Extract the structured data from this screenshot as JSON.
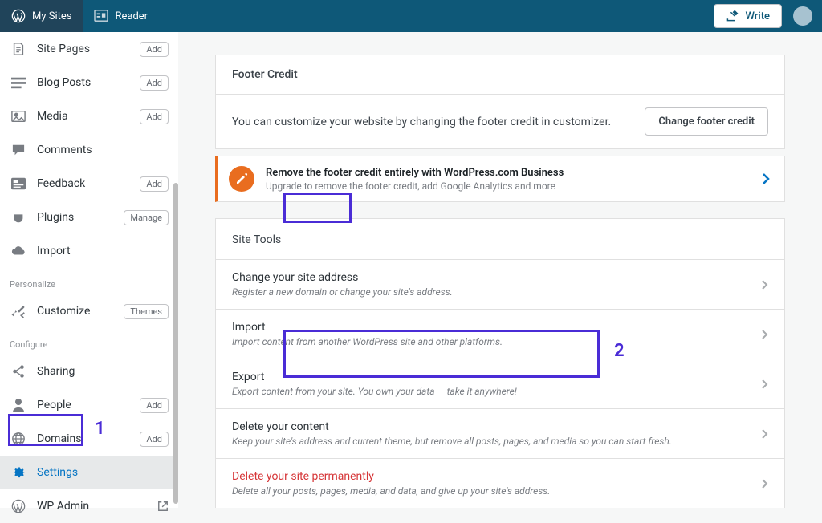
{
  "topbar": {
    "mysites": "My Sites",
    "reader": "Reader",
    "write": "Write"
  },
  "sidebar": {
    "sitepages": {
      "label": "Site Pages",
      "btn": "Add"
    },
    "blogposts": {
      "label": "Blog Posts",
      "btn": "Add"
    },
    "media": {
      "label": "Media",
      "btn": "Add"
    },
    "comments": {
      "label": "Comments"
    },
    "feedback": {
      "label": "Feedback",
      "btn": "Add"
    },
    "plugins": {
      "label": "Plugins",
      "btn": "Manage"
    },
    "import": {
      "label": "Import"
    },
    "personalize_head": "Personalize",
    "customize": {
      "label": "Customize",
      "btn": "Themes"
    },
    "configure_head": "Configure",
    "sharing": {
      "label": "Sharing"
    },
    "people": {
      "label": "People",
      "btn": "Add"
    },
    "domains": {
      "label": "Domains",
      "btn": "Add"
    },
    "settings": {
      "label": "Settings"
    },
    "wpadmin": {
      "label": "WP Admin"
    }
  },
  "footer_credit": {
    "header": "Footer Credit",
    "desc": "You can customize your website by changing the footer credit in customizer.",
    "btn": "Change footer credit"
  },
  "upsell": {
    "title": "Remove the footer credit entirely with WordPress.com Business",
    "sub": "Upgrade to remove the footer credit, add Google Analytics and more"
  },
  "site_tools": {
    "header": "Site Tools",
    "rows": [
      {
        "title": "Change your site address",
        "sub": "Register a new domain or change your site's address."
      },
      {
        "title": "Import",
        "sub": "Import content from another WordPress site and other platforms."
      },
      {
        "title": "Export",
        "sub": "Export content from your site. You own your data — take it anywhere!"
      },
      {
        "title": "Delete your content",
        "sub": "Keep your site's address and current theme, but remove all posts, pages, and media so you can start fresh."
      },
      {
        "title": "Delete your site permanently",
        "sub": "Delete all your posts, pages, media, and data, and give up your site's address.",
        "danger": true
      }
    ]
  },
  "annotations": {
    "one": "1",
    "two": "2"
  }
}
